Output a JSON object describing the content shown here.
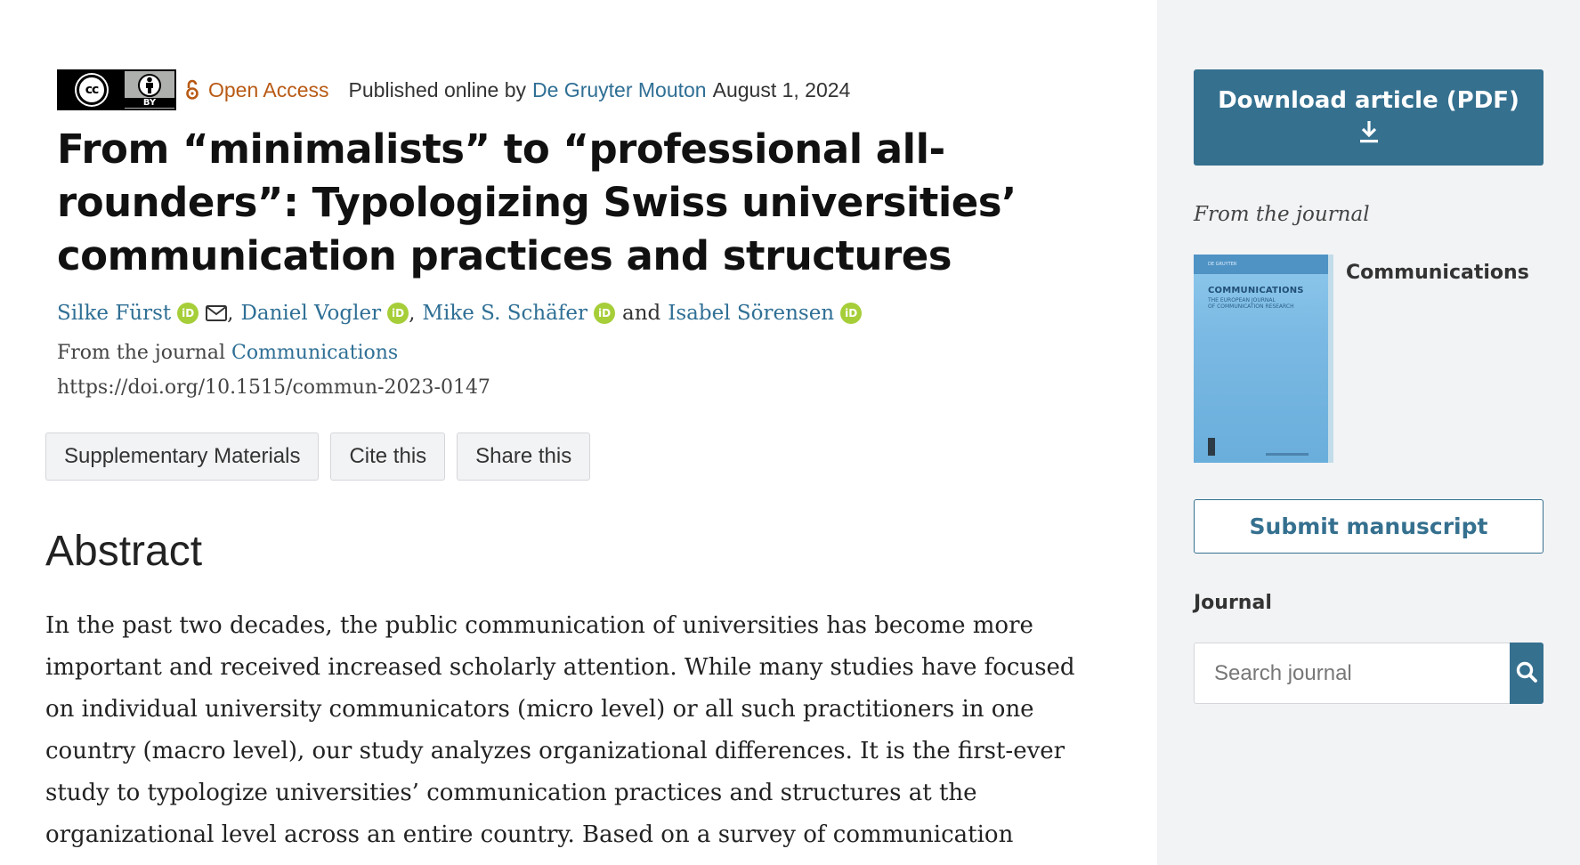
{
  "meta": {
    "license_badge": {
      "cc": "cc",
      "by": "BY"
    },
    "open_access": "Open Access",
    "published_prefix": "Published online by",
    "publisher": "De Gruyter Mouton",
    "date": "August 1, 2024"
  },
  "article": {
    "title": "From “minimalists” to “professional all-rounders”: Typologizing Swiss universities’ communication practices and structures",
    "authors": [
      {
        "name": "Silke Fürst"
      },
      {
        "name": "Daniel Vogler"
      },
      {
        "name": "Mike S. Schäfer"
      },
      {
        "name": "Isabel Sörensen"
      }
    ],
    "author_separator": ",",
    "author_and": "and",
    "from_journal_prefix": "From the journal",
    "journal_link": "Communications",
    "doi": "https://doi.org/10.1515/commun-2023-0147"
  },
  "actions": {
    "supplementary": "Supplementary Materials",
    "cite": "Cite this",
    "share": "Share this"
  },
  "abstract": {
    "heading": "Abstract",
    "text": "In the past two decades, the public communication of universities has become more important and received increased scholarly attention. While many studies have focused on individual university communicators (micro level) or all such practitioners in one country (macro level), our study analyzes organizational differences. It is the first-ever study to typologize universities’ communication practices and structures at the organizational level across an entire country. Based on a survey of communication"
  },
  "sidebar": {
    "download_label": "Download article (PDF)",
    "from_journal": "From the journal",
    "journal_name": "Communications",
    "cover": {
      "publisher": "DE GRUYTER",
      "title": "COMMUNICATIONS",
      "subtitle_line1": "THE EUROPEAN JOURNAL",
      "subtitle_line2": "OF COMMUNICATION RESEARCH"
    },
    "submit_label": "Submit manuscript",
    "journal_label": "Journal",
    "search_placeholder": "Search journal"
  },
  "colors": {
    "accent": "#35708f",
    "link": "#2f6f95",
    "open_access": "#b85a14",
    "orcid": "#a6ce39",
    "sidebar_bg": "#f2f3f5"
  },
  "icons": [
    "open-access-icon",
    "orcid-icon",
    "mail-icon",
    "download-icon",
    "search-icon"
  ]
}
